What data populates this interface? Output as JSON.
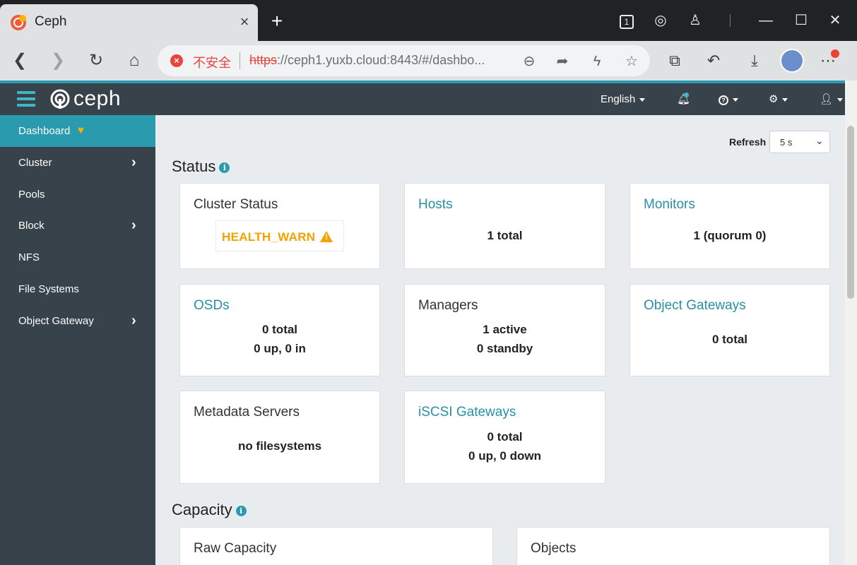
{
  "browser": {
    "tab_title": "Ceph",
    "tab_close": "×",
    "new_tab": "+",
    "security_label": "不安全",
    "url_protocol": "https",
    "url_rest": "://ceph1.yuxb.cloud:8443/#/dashbo...",
    "tab_count": "1"
  },
  "topbar": {
    "logo_text": "ceph",
    "language": "English"
  },
  "sidebar": {
    "items": [
      {
        "label": "Dashboard"
      },
      {
        "label": "Cluster"
      },
      {
        "label": "Pools"
      },
      {
        "label": "Block"
      },
      {
        "label": "NFS"
      },
      {
        "label": "File Systems"
      },
      {
        "label": "Object Gateway"
      }
    ]
  },
  "toolbar": {
    "refresh_label": "Refresh",
    "refresh_value": "5 s"
  },
  "status": {
    "title": "Status",
    "cluster_status": {
      "title": "Cluster Status",
      "value": "HEALTH_WARN"
    },
    "hosts": {
      "title": "Hosts",
      "line1": "1 total"
    },
    "monitors": {
      "title": "Monitors",
      "line1": "1 (quorum 0)"
    },
    "osds": {
      "title": "OSDs",
      "line1": "0 total",
      "line2": "0 up, 0 in"
    },
    "managers": {
      "title": "Managers",
      "line1": "1 active",
      "line2": "0 standby"
    },
    "object_gateways": {
      "title": "Object Gateways",
      "line1": "0 total"
    },
    "metadata_servers": {
      "title": "Metadata Servers",
      "line1": "no filesystems"
    },
    "iscsi_gateways": {
      "title": "iSCSI Gateways",
      "line1": "0 total",
      "line2": "0 up, 0 down"
    }
  },
  "capacity": {
    "title": "Capacity",
    "raw_capacity": {
      "title": "Raw Capacity"
    },
    "objects": {
      "title": "Objects"
    }
  },
  "colors": {
    "accent": "#2a9aaf",
    "sidebar_bg": "#37424a",
    "warning": "#f5a100"
  }
}
